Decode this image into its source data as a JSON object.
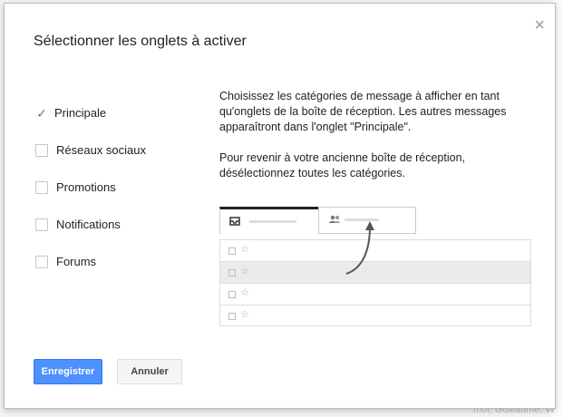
{
  "dialog": {
    "title": "Sélectionner les onglets à activer",
    "close_symbol": "×"
  },
  "categories": [
    {
      "label": "Principale",
      "checked": true
    },
    {
      "label": "Réseaux sociaux",
      "checked": false
    },
    {
      "label": "Promotions",
      "checked": false
    },
    {
      "label": "Notifications",
      "checked": false
    },
    {
      "label": "Forums",
      "checked": false
    }
  ],
  "description": {
    "paragraph1": "Choisissez les catégories de message à afficher en tant qu'onglets de la boîte de réception. Les autres messages apparaîtront dans l'onglet \"Principale\".",
    "paragraph2": "Pour revenir à votre ancienne boîte de réception, désélectionnez toutes les catégories."
  },
  "buttons": {
    "save_label": "Enregistrer",
    "cancel_label": "Annuler"
  },
  "background": {
    "partial_text": "moi, Guillaume, W"
  },
  "colors": {
    "primary_button": "#4d90fe",
    "primary_button_border": "#3079ed"
  }
}
